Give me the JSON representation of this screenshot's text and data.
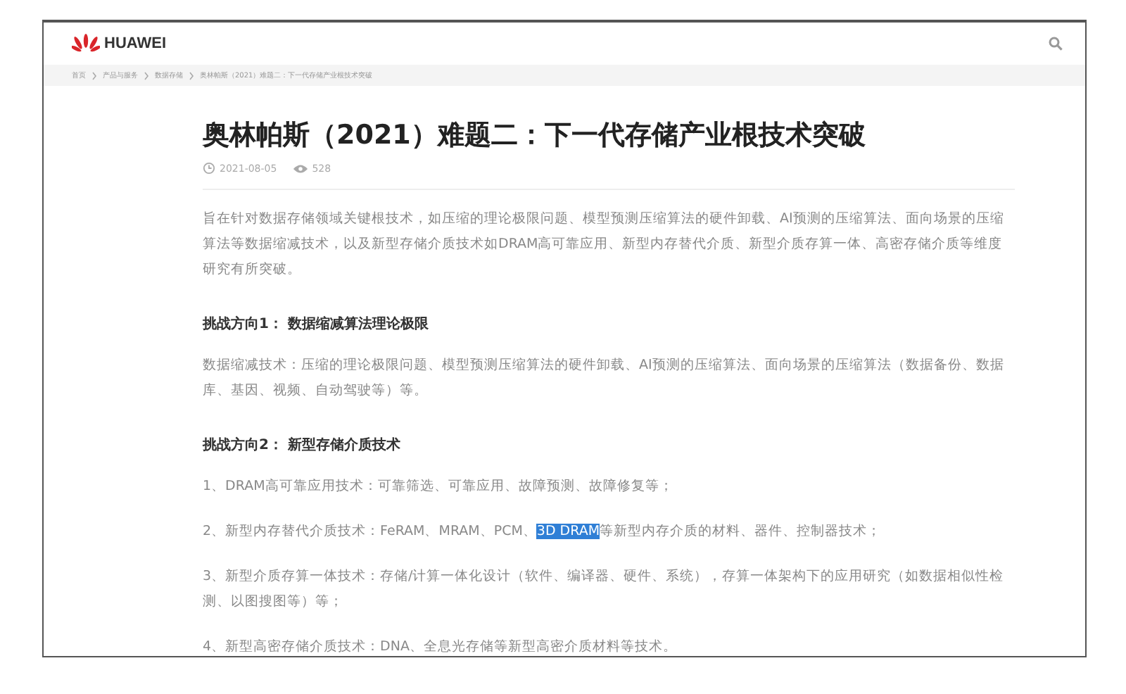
{
  "header": {
    "brand": "HUAWEI"
  },
  "breadcrumb": [
    "首页",
    "产品与服务",
    "数据存储",
    "奥林帕斯（2021）难题二：下一代存储产业根技术突破"
  ],
  "article": {
    "title": "奥林帕斯（2021）难题二：下一代存储产业根技术突破",
    "date": "2021-08-05",
    "views": "528",
    "intro": "旨在针对数据存储领域关键根技术，如压缩的理论极限问题、模型预测压缩算法的硬件卸载、AI预测的压缩算法、面向场景的压缩算法等数据缩减技术，以及新型存储介质技术如DRAM高可靠应用、新型内存替代介质、新型介质存算一体、高密存储介质等维度研究有所突破。",
    "sections": [
      {
        "heading": "挑战方向1：  数据缩减算法理论极限",
        "paragraphs": [
          [
            {
              "text": "数据缩减技术：压缩的理论极限问题、模型预测压缩算法的硬件卸载、AI预测的压缩算法、面向场景的压缩算法（数据备份、数据库、基因、视频、自动驾驶等）等。",
              "selected": false
            }
          ]
        ]
      },
      {
        "heading": "挑战方向2：  新型存储介质技术",
        "paragraphs": [
          [
            {
              "text": "1、DRAM高可靠应用技术：可靠筛选、可靠应用、故障预测、故障修复等；",
              "selected": false
            }
          ],
          [
            {
              "text": "2、新型内存替代介质技术：FeRAM、MRAM、PCM、",
              "selected": false
            },
            {
              "text": "3D DRAM",
              "selected": true
            },
            {
              "text": "等新型内存介质的材料、器件、控制器技术；",
              "selected": false
            }
          ],
          [
            {
              "text": "3、新型介质存算一体技术：存储/计算一体化设计（软件、编译器、硬件、系统），存算一体架构下的应用研究（如数据相似性检测、以图搜图等）等；",
              "selected": false
            }
          ],
          [
            {
              "text": "4、新型高密存储介质技术：DNA、全息光存储等新型高密介质材料等技术。",
              "selected": false
            }
          ]
        ]
      }
    ]
  }
}
